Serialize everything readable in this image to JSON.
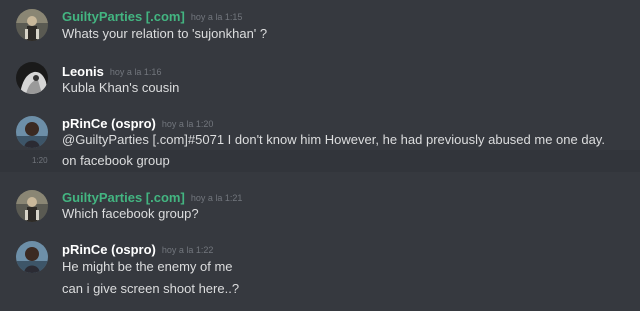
{
  "messages": [
    {
      "username": "GuiltyParties [.com]",
      "timestamp": "hoy a la 1:15",
      "lines": [
        "Whats your relation to 'sujonkhan' ?"
      ]
    },
    {
      "username": "Leonis",
      "timestamp": "hoy a la 1:16",
      "lines": [
        "Kubla Khan's cousin"
      ]
    },
    {
      "username": "pRinCe (ospro)",
      "timestamp": "hoy a la 1:20",
      "lines": [
        "@GuiltyParties [.com]#5071 I don't know him  However, he had previously abused me one day."
      ],
      "followup": {
        "side_time": "1:20",
        "text": "on facebook group"
      }
    },
    {
      "username": "GuiltyParties [.com]",
      "timestamp": "hoy a la 1:21",
      "lines": [
        "Which facebook group?"
      ]
    },
    {
      "username": "pRinCe (ospro)",
      "timestamp": "hoy a la 1:22",
      "lines": [
        "He might be the enemy of me",
        "can i give screen shoot here..?"
      ]
    }
  ],
  "colors": {
    "background": "#36393f",
    "username_green": "#43b581",
    "username_white": "#ffffff",
    "message_text": "#dcddde",
    "timestamp": "#72767d",
    "hover_row": "#32353b"
  },
  "icons": [
    "avatar-guiltyparties",
    "avatar-leonis",
    "avatar-prince"
  ]
}
